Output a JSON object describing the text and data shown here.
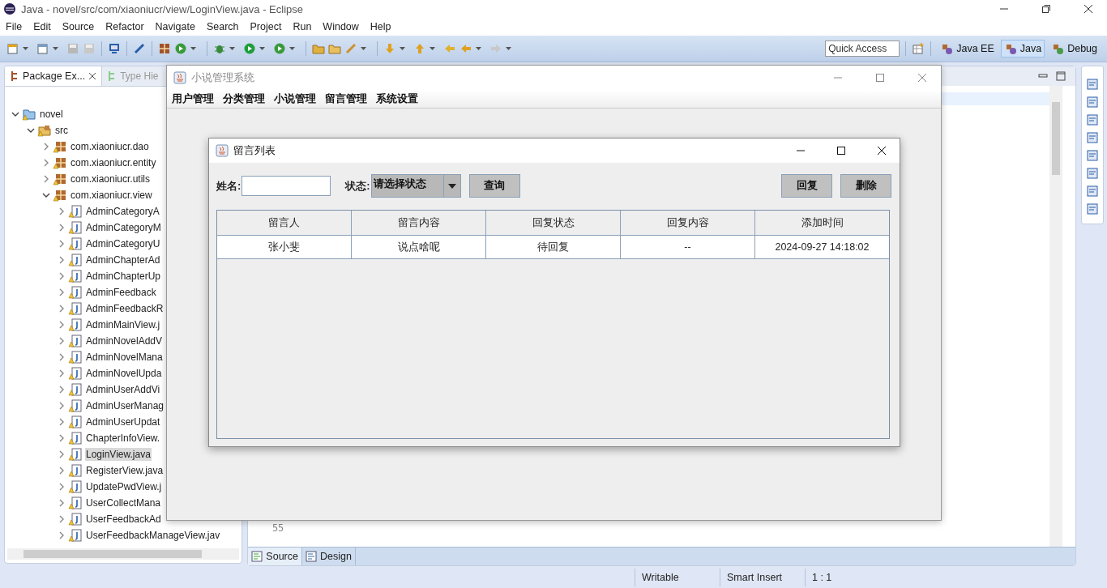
{
  "window": {
    "title": "Java - novel/src/com/xiaoniucr/view/LoginView.java - Eclipse"
  },
  "menu": [
    "File",
    "Edit",
    "Source",
    "Refactor",
    "Navigate",
    "Search",
    "Project",
    "Run",
    "Window",
    "Help"
  ],
  "quick_access": {
    "placeholder": "Quick Access"
  },
  "perspectives": [
    {
      "label": "Java EE",
      "selected": false
    },
    {
      "label": "Java",
      "selected": true
    },
    {
      "label": "Debug",
      "selected": false
    }
  ],
  "left_panel": {
    "tabs": [
      {
        "label": "Package Ex...",
        "selected": true
      },
      {
        "label": "Type Hie",
        "selected": false
      }
    ],
    "tree": [
      {
        "label": "novel",
        "kind": "project",
        "expanded": true,
        "selected": false,
        "children": [
          {
            "label": "src",
            "kind": "folder",
            "expanded": true,
            "selected": false,
            "children": [
              {
                "label": "com.xiaoniucr.dao",
                "kind": "package",
                "expanded": false,
                "selected": false
              },
              {
                "label": "com.xiaoniucr.entity",
                "kind": "package",
                "expanded": false,
                "selected": false
              },
              {
                "label": "com.xiaoniucr.utils",
                "kind": "package",
                "expanded": false,
                "selected": false
              },
              {
                "label": "com.xiaoniucr.view",
                "kind": "package",
                "expanded": true,
                "selected": false,
                "children": [
                  {
                    "label": "AdminCategoryA",
                    "kind": "file",
                    "expanded": false,
                    "selected": false
                  },
                  {
                    "label": "AdminCategoryM",
                    "kind": "file",
                    "expanded": false,
                    "selected": false
                  },
                  {
                    "label": "AdminCategoryU",
                    "kind": "file",
                    "expanded": false,
                    "selected": false
                  },
                  {
                    "label": "AdminChapterAd",
                    "kind": "file",
                    "expanded": false,
                    "selected": false
                  },
                  {
                    "label": "AdminChapterUp",
                    "kind": "file",
                    "expanded": false,
                    "selected": false
                  },
                  {
                    "label": "AdminFeedback",
                    "kind": "file",
                    "expanded": false,
                    "selected": false
                  },
                  {
                    "label": "AdminFeedbackR",
                    "kind": "file",
                    "expanded": false,
                    "selected": false
                  },
                  {
                    "label": "AdminMainView.j",
                    "kind": "file",
                    "expanded": false,
                    "selected": false
                  },
                  {
                    "label": "AdminNovelAddV",
                    "kind": "file",
                    "expanded": false,
                    "selected": false
                  },
                  {
                    "label": "AdminNovelMana",
                    "kind": "file",
                    "expanded": false,
                    "selected": false
                  },
                  {
                    "label": "AdminNovelUpda",
                    "kind": "file",
                    "expanded": false,
                    "selected": false
                  },
                  {
                    "label": "AdminUserAddVi",
                    "kind": "file",
                    "expanded": false,
                    "selected": false
                  },
                  {
                    "label": "AdminUserManag",
                    "kind": "file",
                    "expanded": false,
                    "selected": false
                  },
                  {
                    "label": "AdminUserUpdat",
                    "kind": "file",
                    "expanded": false,
                    "selected": false
                  },
                  {
                    "label": "ChapterInfoView.",
                    "kind": "file",
                    "expanded": false,
                    "selected": false
                  },
                  {
                    "label": "LoginView.java",
                    "kind": "file",
                    "expanded": false,
                    "selected": true
                  },
                  {
                    "label": "RegisterView.java",
                    "kind": "file",
                    "expanded": false,
                    "selected": false
                  },
                  {
                    "label": "UpdatePwdView.j",
                    "kind": "file",
                    "expanded": false,
                    "selected": false
                  },
                  {
                    "label": "UserCollectMana",
                    "kind": "file",
                    "expanded": false,
                    "selected": false
                  },
                  {
                    "label": "UserFeedbackAd",
                    "kind": "file",
                    "expanded": false,
                    "selected": false
                  },
                  {
                    "label": "UserFeedbackManageView.jav",
                    "kind": "file",
                    "expanded": false,
                    "selected": false
                  }
                ]
              }
            ]
          }
        ]
      }
    ]
  },
  "editor": {
    "line_number": "55",
    "bottom_tabs": [
      {
        "label": "Source",
        "selected": true
      },
      {
        "label": "Design",
        "selected": false
      }
    ]
  },
  "status_bar": [
    "Writable",
    "Smart Insert",
    "1 : 1"
  ],
  "app_window": {
    "title": "小说管理系统",
    "menu": [
      "用户管理",
      "分类管理",
      "小说管理",
      "留言管理",
      "系统设置"
    ]
  },
  "dialog": {
    "title": "留言列表",
    "name_label": "姓名:",
    "status_label": "状态:",
    "status_select": "请选择状态",
    "query_button": "查询",
    "action_buttons": [
      "回复",
      "删除"
    ],
    "table": {
      "columns": [
        "留言人",
        "留言内容",
        "回复状态",
        "回复内容",
        "添加时间"
      ],
      "rows": [
        [
          "张小斐",
          "说点啥呢",
          "待回复",
          "--",
          "2024-09-27 14:18:02"
        ]
      ]
    }
  }
}
